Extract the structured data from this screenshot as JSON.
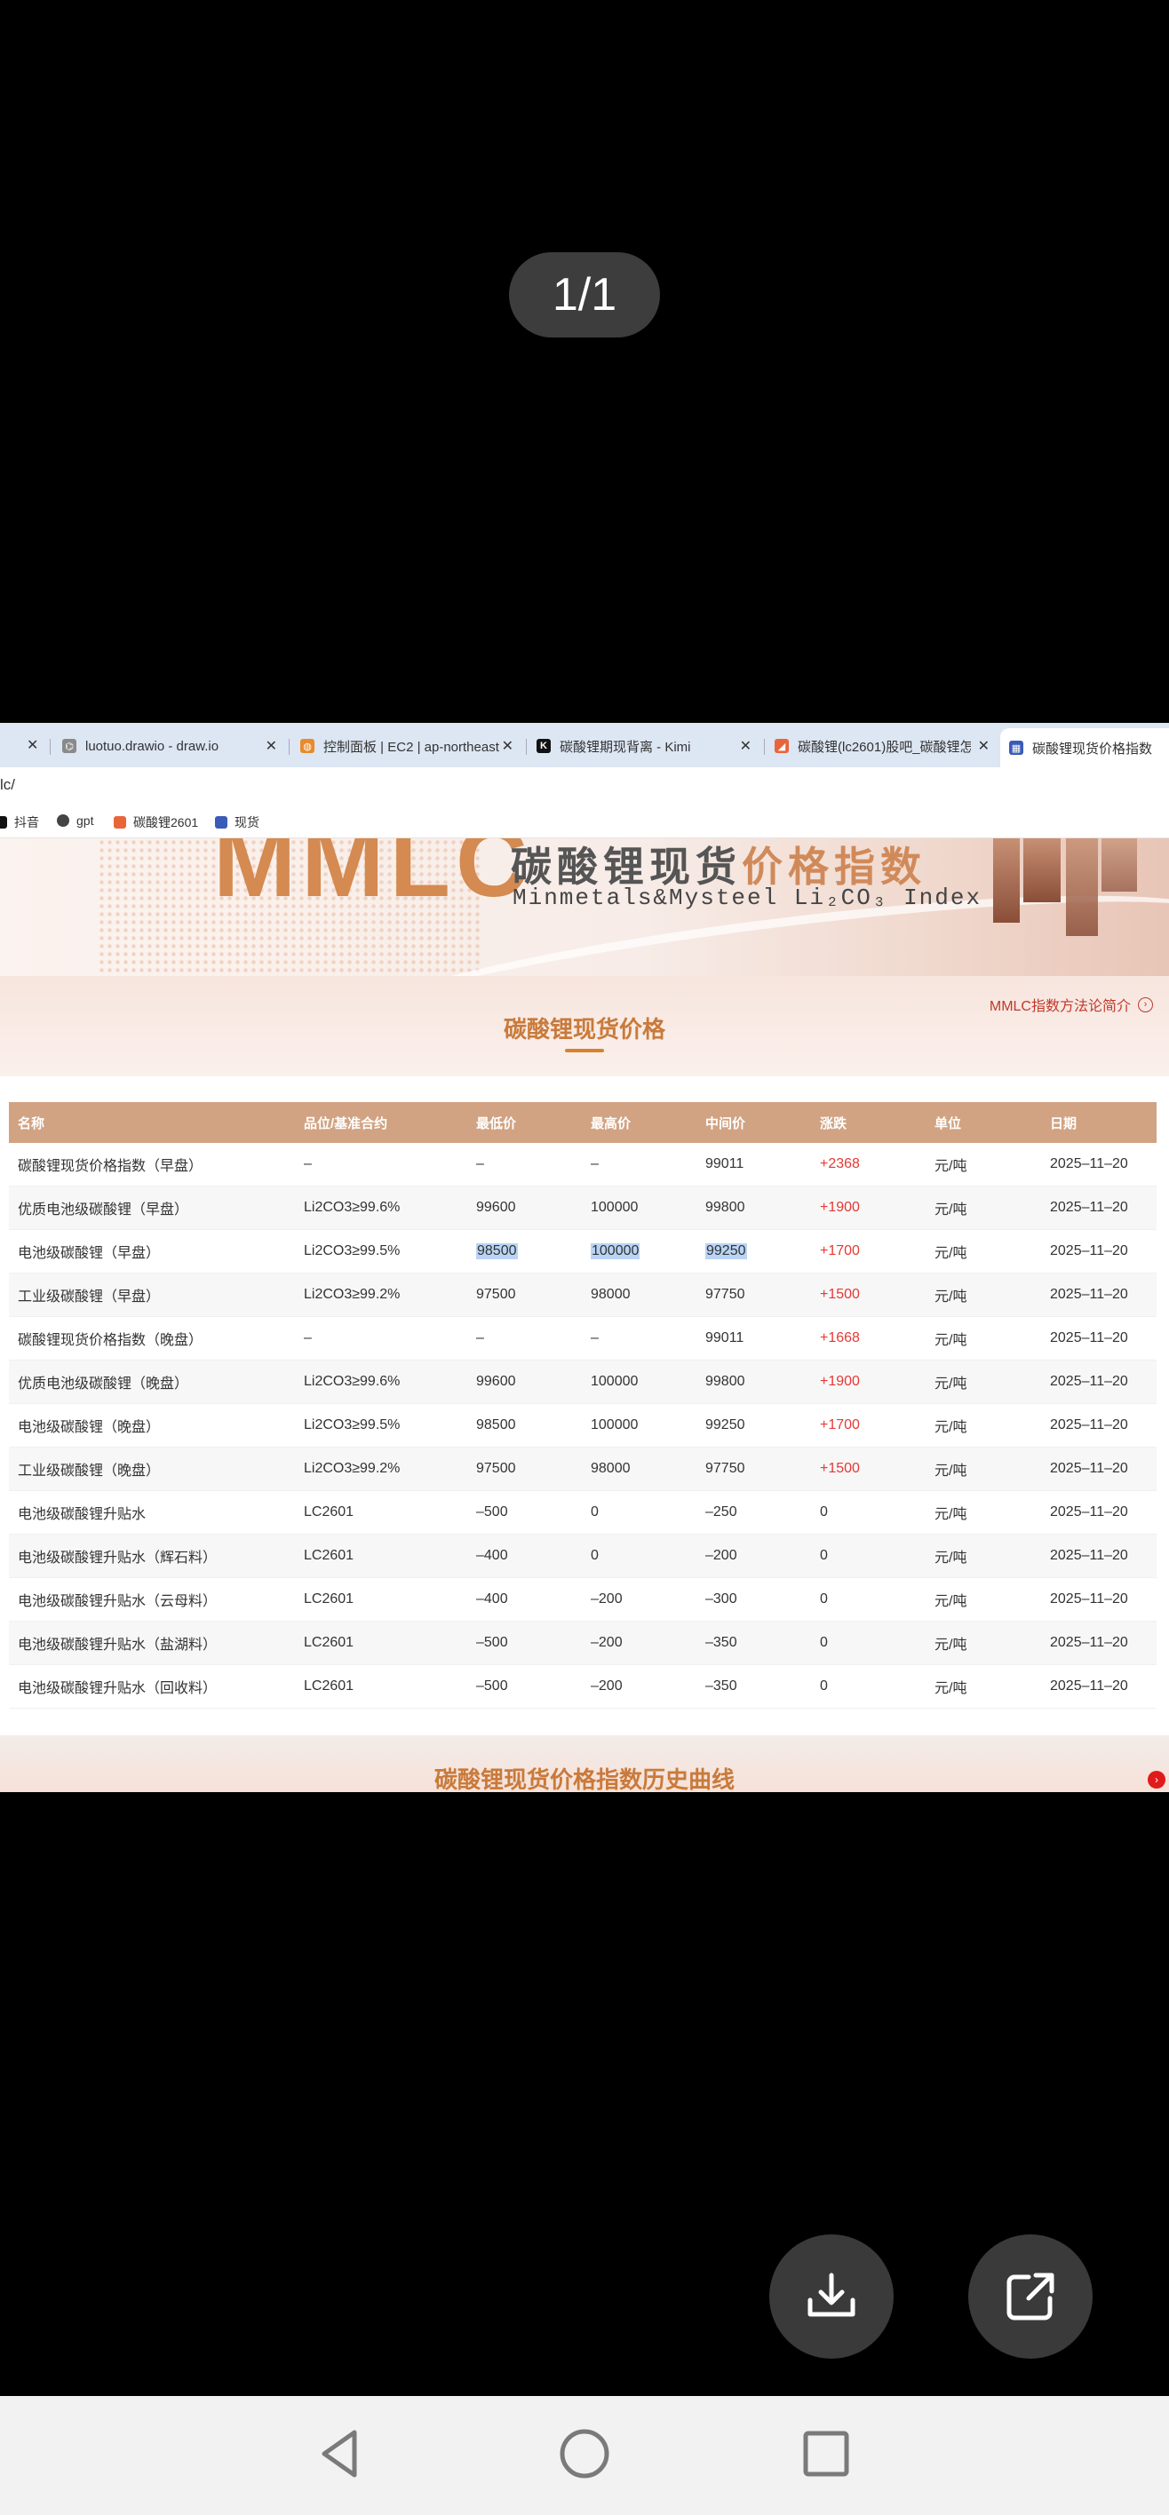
{
  "viewer": {
    "page_counter": "1/1"
  },
  "browser": {
    "tabs": [
      {
        "title": "luotuo.drawio - draw.io",
        "icon": "drawio-icon",
        "color": "#7a7a7a"
      },
      {
        "title": "控制面板 | EC2 | ap-northeast",
        "icon": "aws-icon",
        "color": "#e88b2d"
      },
      {
        "title": "碳酸锂期现背离 - Kimi",
        "icon": "kimi-icon",
        "color": "#111111"
      },
      {
        "title": "碳酸锂(lc2601)股吧_碳酸锂怎",
        "icon": "eastmoney-icon",
        "color": "#e8653a"
      },
      {
        "title": "碳酸锂现货价格指数",
        "icon": "mysteel-icon",
        "color": "#3a5bb8"
      }
    ],
    "url_fragment": "lc/",
    "bookmarks": [
      {
        "label": "抖音",
        "icon": "douyin-icon"
      },
      {
        "label": "gpt",
        "icon": "openai-icon"
      },
      {
        "label": "碳酸锂2601",
        "icon": "eastmoney-icon"
      },
      {
        "label": "现货",
        "icon": "mysteel-icon"
      }
    ]
  },
  "banner": {
    "logo": "MMLC",
    "cn_title_plain": "碳酸锂现货",
    "cn_title_accent": "价格指数",
    "en_title": "Minmetals&Mysteel Li₂CO₃ Index"
  },
  "section": {
    "method_link": "MMLC指数方法论简介",
    "title": "碳酸锂现货价格"
  },
  "table": {
    "headers": [
      "名称",
      "品位/基准合约",
      "最低价",
      "最高价",
      "中间价",
      "涨跌",
      "单位",
      "日期"
    ],
    "rows": [
      [
        "碳酸锂现货价格指数（早盘）",
        "–",
        "–",
        "–",
        "99011",
        "+2368",
        "元/吨",
        "2025–11–20"
      ],
      [
        "优质电池级碳酸锂（早盘）",
        "Li2CO3≥99.6%",
        "99600",
        "100000",
        "99800",
        "+1900",
        "元/吨",
        "2025–11–20"
      ],
      [
        "电池级碳酸锂（早盘）",
        "Li2CO3≥99.5%",
        "98500",
        "100000",
        "99250",
        "+1700",
        "元/吨",
        "2025–11–20"
      ],
      [
        "工业级碳酸锂（早盘）",
        "Li2CO3≥99.2%",
        "97500",
        "98000",
        "97750",
        "+1500",
        "元/吨",
        "2025–11–20"
      ],
      [
        "碳酸锂现货价格指数（晚盘）",
        "–",
        "–",
        "–",
        "99011",
        "+1668",
        "元/吨",
        "2025–11–20"
      ],
      [
        "优质电池级碳酸锂（晚盘）",
        "Li2CO3≥99.6%",
        "99600",
        "100000",
        "99800",
        "+1900",
        "元/吨",
        "2025–11–20"
      ],
      [
        "电池级碳酸锂（晚盘）",
        "Li2CO3≥99.5%",
        "98500",
        "100000",
        "99250",
        "+1700",
        "元/吨",
        "2025–11–20"
      ],
      [
        "工业级碳酸锂（晚盘）",
        "Li2CO3≥99.2%",
        "97500",
        "98000",
        "97750",
        "+1500",
        "元/吨",
        "2025–11–20"
      ],
      [
        "电池级碳酸锂升贴水",
        "LC2601",
        "–500",
        "0",
        "–250",
        "0",
        "元/吨",
        "2025–11–20"
      ],
      [
        "电池级碳酸锂升贴水（辉石料）",
        "LC2601",
        "–400",
        "0",
        "–200",
        "0",
        "元/吨",
        "2025–11–20"
      ],
      [
        "电池级碳酸锂升贴水（云母料）",
        "LC2601",
        "–400",
        "–200",
        "–300",
        "0",
        "元/吨",
        "2025–11–20"
      ],
      [
        "电池级碳酸锂升贴水（盐湖料）",
        "LC2601",
        "–500",
        "–200",
        "–350",
        "0",
        "元/吨",
        "2025–11–20"
      ],
      [
        "电池级碳酸锂升贴水（回收料）",
        "LC2601",
        "–500",
        "–200",
        "–350",
        "0",
        "元/吨",
        "2025–11–20"
      ]
    ],
    "selected_row": 2,
    "selected_cols": [
      2,
      3,
      4
    ],
    "up_color": "#e53935",
    "header_color": "#d1a383"
  },
  "bottom_section": {
    "title": "碳酸锂现货价格指数历史曲线"
  },
  "actions": {
    "download": "download-icon",
    "share": "share-icon"
  },
  "nav": {
    "back": "back-icon",
    "home": "home-icon",
    "recents": "recents-icon"
  }
}
